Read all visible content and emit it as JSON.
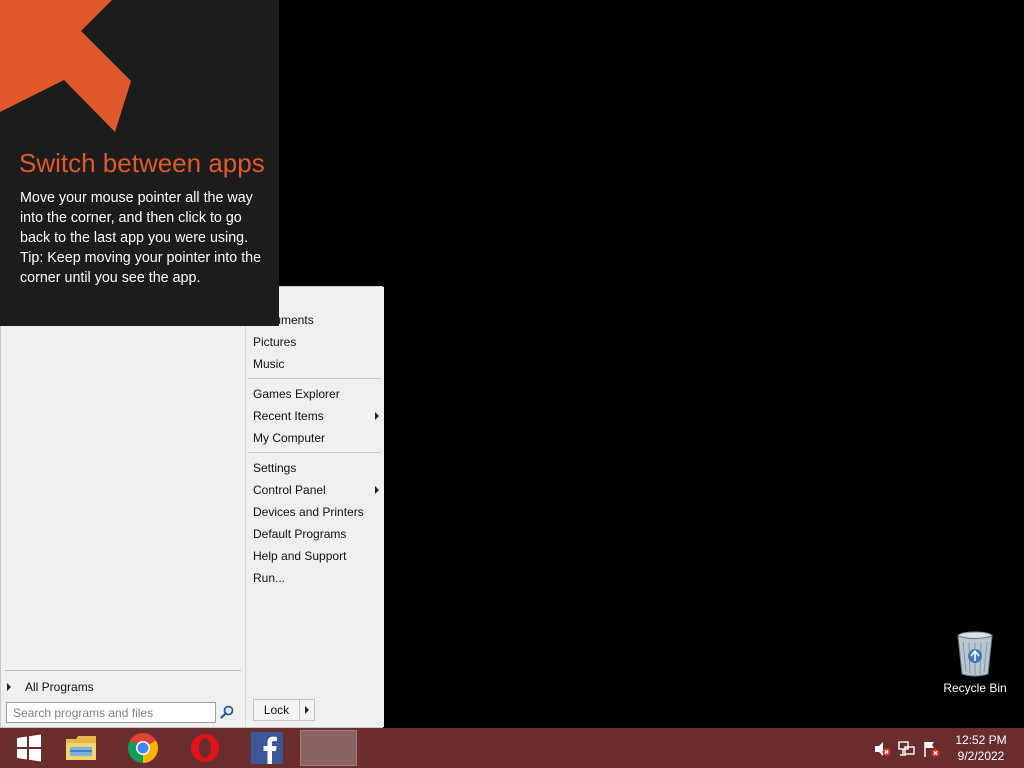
{
  "tip": {
    "title": "Switch between apps",
    "line1": "Move your mouse pointer all the way into the corner, and then click to go back to the last app you were using.",
    "line2": "Tip: Keep moving your pointer into the corner until you see the app.",
    "accent_color": "#e0592a"
  },
  "start_menu": {
    "right_items_group1": [
      {
        "label": "Documents",
        "icon": "none"
      },
      {
        "label": "Pictures"
      },
      {
        "label": "Music"
      }
    ],
    "right_items_group2": [
      {
        "label": "Games Explorer"
      },
      {
        "label": "Recent Items",
        "has_submenu": true
      },
      {
        "label": "My Computer"
      }
    ],
    "right_items_group3": [
      {
        "label": "Settings"
      },
      {
        "label": "Control Panel",
        "has_submenu": true
      },
      {
        "label": "Devices and Printers"
      },
      {
        "label": "Default Programs"
      },
      {
        "label": "Help and Support"
      },
      {
        "label": "Run..."
      }
    ],
    "all_programs_label": "All Programs",
    "search_placeholder": "Search programs and files",
    "lock_label": "Lock"
  },
  "desktop": {
    "recycle_bin_label": "Recycle Bin"
  },
  "taskbar": {
    "color": "#6b2e2e",
    "pinned": [
      "start-icon",
      "file-explorer-icon",
      "chrome-icon",
      "opera-icon",
      "facebook-icon"
    ],
    "tray_icons": [
      "volume-muted-icon",
      "network-icon",
      "action-center-flag-icon"
    ],
    "clock_time": "12:52 PM",
    "clock_date": "9/2/2022"
  }
}
